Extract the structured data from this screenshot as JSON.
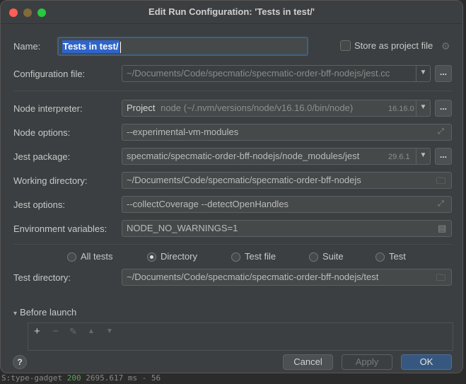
{
  "window": {
    "title": "Edit Run Configuration: 'Tests in test/'"
  },
  "name": {
    "label": "Name:",
    "value": "Tests in test/"
  },
  "store_as_project_file": {
    "label": "Store as project file",
    "checked": false
  },
  "configuration_file": {
    "label": "Configuration file:",
    "value": "~/Documents/Code/specmatic/specmatic-order-bff-nodejs/jest.cc"
  },
  "node_interpreter": {
    "label": "Node interpreter:",
    "kind": "Project",
    "path": "node (~/.nvm/versions/node/v16.16.0/bin/node)",
    "version": "16.16.0"
  },
  "node_options": {
    "label": "Node options:",
    "value": "--experimental-vm-modules"
  },
  "jest_package": {
    "label": "Jest package:",
    "value": "specmatic/specmatic-order-bff-nodejs/node_modules/jest",
    "version": "29.6.1"
  },
  "working_directory": {
    "label": "Working directory:",
    "value": "~/Documents/Code/specmatic/specmatic-order-bff-nodejs"
  },
  "jest_options": {
    "label": "Jest options:",
    "value": "--collectCoverage --detectOpenHandles"
  },
  "environment_variables": {
    "label": "Environment variables:",
    "value": "NODE_NO_WARNINGS=1"
  },
  "test_scope": {
    "options": [
      "All tests",
      "Directory",
      "Test file",
      "Suite",
      "Test"
    ],
    "selected": "Directory"
  },
  "test_directory": {
    "label": "Test directory:",
    "value": "~/Documents/Code/specmatic/specmatic-order-bff-nodejs/test"
  },
  "before_launch": {
    "label": "Before launch"
  },
  "buttons": {
    "help": "?",
    "cancel": "Cancel",
    "apply": "Apply",
    "ok": "OK",
    "browse": "..."
  },
  "backdrop": {
    "line_prefix": "S:type-gadget",
    "status": "200",
    "line_rest": "2695.617 ms - 56"
  },
  "colors": {
    "dialog_bg": "#3c3f41",
    "field_bg": "#45494a",
    "selection": "#2f65ca",
    "ok_button": "#365880"
  },
  "icons": {
    "dropdown": "chevron-down-icon",
    "expand": "expand-icon",
    "folder": "folder-icon",
    "document": "document-icon",
    "gear": "gear-icon",
    "add": "plus-icon",
    "remove": "minus-icon",
    "edit": "pencil-icon",
    "up": "arrow-up-icon",
    "down": "arrow-down-icon"
  }
}
